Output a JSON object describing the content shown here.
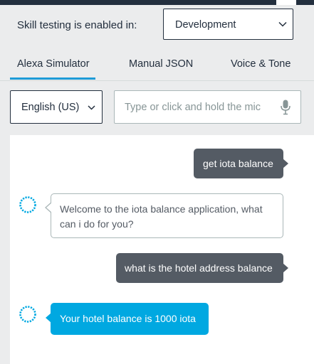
{
  "header": {
    "env_label": "Skill testing is enabled in:",
    "env_value": "Development"
  },
  "tabs": [
    {
      "label": "Alexa Simulator",
      "active": true
    },
    {
      "label": "Manual JSON",
      "active": false
    },
    {
      "label": "Voice & Tone",
      "active": false
    }
  ],
  "input": {
    "language": "English (US)",
    "placeholder": "Type or click and hold the mic"
  },
  "conversation": [
    {
      "speaker": "user",
      "text": "get iota balance"
    },
    {
      "speaker": "alexa",
      "text": "Welcome to the iota balance application, what can i do for you?"
    },
    {
      "speaker": "user",
      "text": "what is the hotel address balance"
    },
    {
      "speaker": "alexa",
      "text": "Your hotel balance is 1000 iota"
    }
  ],
  "colors": {
    "accent": "#1e9bd7",
    "user_bubble": "#545b64",
    "alexa_highlight": "#00a8e1",
    "topbar": "#232f3e"
  },
  "icons": {
    "dropdown": "chevron-down-icon",
    "mic": "microphone-icon",
    "alexa_avatar": "alexa-ring-icon"
  }
}
